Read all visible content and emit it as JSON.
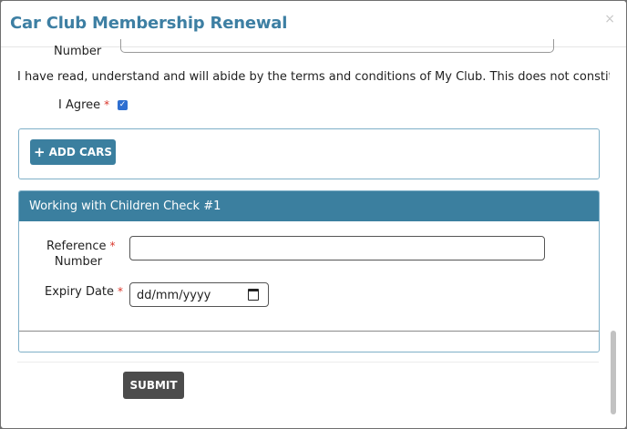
{
  "modal": {
    "title": "Car Club Membership Renewal",
    "close_symbol": "×"
  },
  "form": {
    "partial_label": "Number",
    "terms_text": "I have read, understand and will abide by the terms and conditions of My Club. This does not constitute.",
    "agree_label": "I Agree",
    "agree_checked": true,
    "required_mark": "*",
    "add_cars_label": "ADD CARS",
    "add_cars_icon": "plus-icon"
  },
  "wwcc": {
    "heading": "Working with Children Check #1",
    "reference_label_line1": "Reference",
    "reference_label_line2": "Number",
    "reference_value": "",
    "expiry_label": "Expiry Date",
    "expiry_placeholder": "dd/mm/yyyy",
    "expiry_icon": "calendar-icon"
  },
  "footer": {
    "submit_label": "SUBMIT"
  },
  "colors": {
    "accent": "#3b7f9f",
    "title": "#3d7fa3",
    "required": "#d9352a",
    "submit": "#4c4c4c"
  }
}
